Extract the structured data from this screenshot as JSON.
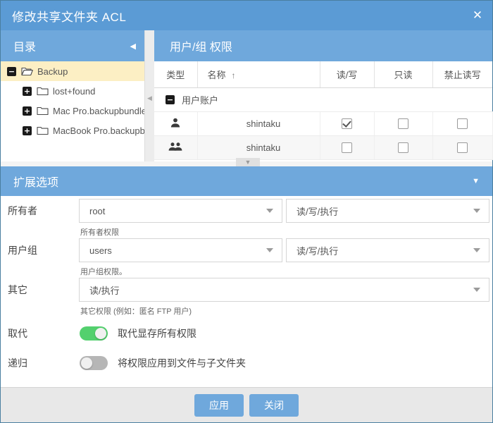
{
  "window": {
    "title": "修改共享文件夹 ACL",
    "close_icon": "close-icon"
  },
  "directory_panel": {
    "title": "目录",
    "collapse_icon": "◀",
    "tree": [
      {
        "label": "Backup",
        "depth": 0,
        "expander": "−",
        "selected": true,
        "folder": "open"
      },
      {
        "label": "lost+found",
        "depth": 1,
        "expander": "+",
        "selected": false,
        "folder": "closed"
      },
      {
        "label": "Mac Pro.backupbundle",
        "depth": 1,
        "expander": "+",
        "selected": false,
        "folder": "closed"
      },
      {
        "label": "MacBook Pro.backupbundle",
        "depth": 1,
        "expander": "+",
        "selected": false,
        "folder": "closed"
      }
    ]
  },
  "splitter": {
    "vertical_grip": "◀",
    "horizontal_grip": "▼"
  },
  "permissions_panel": {
    "title": "用户/组 权限",
    "columns": {
      "type": "类型",
      "name": "名称",
      "name_sort": "↑",
      "read_write": "读/写",
      "read_only": "只读",
      "deny": "禁止读写"
    },
    "groups": [
      {
        "label": "用户账户",
        "expander": "−",
        "rows": [
          {
            "icon": "user-icon",
            "name": "shintaku",
            "read_write": true,
            "read_only": false,
            "deny": false
          },
          {
            "icon": "group-icon",
            "name": "shintaku",
            "read_write": false,
            "read_only": false,
            "deny": false
          }
        ]
      }
    ]
  },
  "extended_options": {
    "title": "扩展选项",
    "collapse_icon": "▼",
    "owner": {
      "label": "所有者",
      "name_value": "root",
      "perm_value": "读/写/执行",
      "hint": "所有者权限"
    },
    "group": {
      "label": "用户组",
      "name_value": "users",
      "perm_value": "读/写/执行",
      "hint": "用户组权限。"
    },
    "others": {
      "label": "其它",
      "perm_value": "读/执行",
      "hint": "其它权限 (例如：匿名 FTP 用户)"
    },
    "replace": {
      "label": "取代",
      "text": "取代显存所有权限",
      "on": true
    },
    "recursive": {
      "label": "递归",
      "text": "将权限应用到文件与子文件夹",
      "on": false
    }
  },
  "footer": {
    "apply": "应用",
    "close": "关闭"
  },
  "colors": {
    "accent": "#5b9bd5",
    "panel_header": "#6fa8dc",
    "selection": "#fcefc4",
    "toggle_on": "#53d06e",
    "toggle_off": "#b6b6b6"
  }
}
